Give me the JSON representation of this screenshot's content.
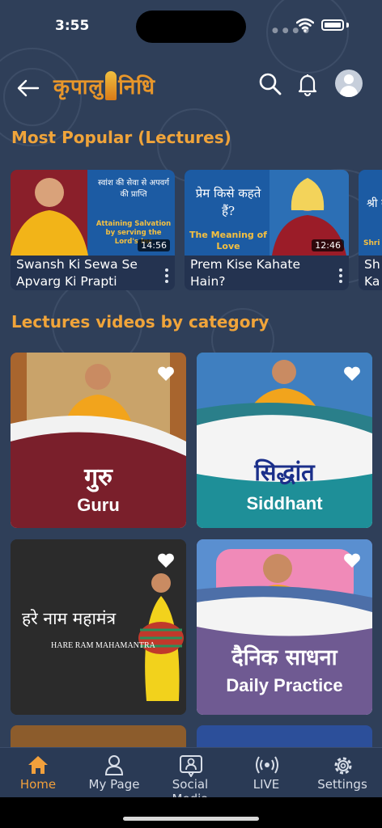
{
  "status": {
    "time": "3:55"
  },
  "header": {
    "back_icon": "arrow-left-icon",
    "logo_text_left": "कृपालु",
    "logo_text_right": "निधि",
    "search_icon": "search-icon",
    "bell_icon": "bell-icon",
    "profile_icon": "user-avatar-icon"
  },
  "popular": {
    "title": "Most Popular (Lectures)",
    "items": [
      {
        "title": "Swansh Ki Sewa Se Apvarg Ki Prapti",
        "duration": "14:56",
        "thumb_hi": "स्वांश की सेवा से अपवर्ग की प्राप्ति",
        "thumb_en": "Attaining Salvation by serving the Lord's Inc"
      },
      {
        "title": "Prem Kise Kahate Hain?",
        "duration": "12:46",
        "thumb_hi": "प्रेम किसे कहते हैं?",
        "thumb_en": "The Meaning of Love"
      },
      {
        "title": "Sh Ka",
        "thumb_hi": "श्री क",
        "thumb_en": "Shri"
      }
    ]
  },
  "categories": {
    "title": "Lectures videos by category",
    "items": [
      {
        "hindi": "गुरु",
        "english": "Guru",
        "color": "#7a1f2b"
      },
      {
        "hindi": "सिद्धांत",
        "english": "Siddhant",
        "color": "#1e8f98"
      },
      {
        "hindi": "हरे नाम महामंत्र",
        "english": "HARE RAM MAHAMANTRA",
        "color": "#2b2b2b"
      },
      {
        "hindi": "दैनिक साधना",
        "english": "Daily Practice",
        "color": "#6f5a92"
      }
    ]
  },
  "nav": {
    "items": [
      {
        "label": "Home",
        "icon": "home-icon",
        "active": true
      },
      {
        "label": "My Page",
        "icon": "person-icon"
      },
      {
        "label": "Social Media",
        "icon": "chat-person-icon"
      },
      {
        "label": "LIVE",
        "icon": "broadcast-icon"
      },
      {
        "label": "Settings",
        "icon": "gear-icon"
      }
    ]
  },
  "colors": {
    "background": "#2f3f59",
    "accent": "#f0a43a"
  }
}
